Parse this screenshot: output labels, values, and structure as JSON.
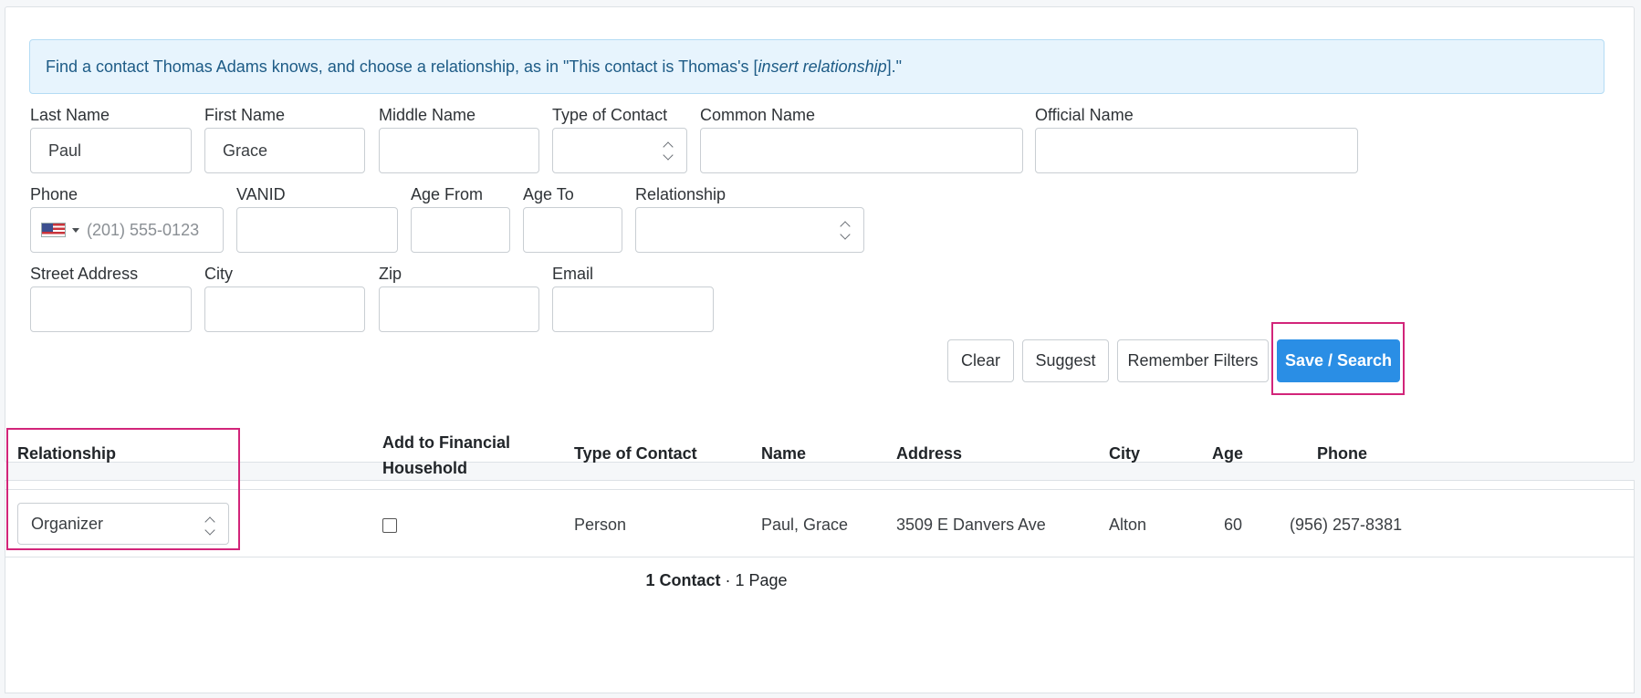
{
  "alert": {
    "prefix": "Find a contact Thomas Adams knows, and choose a relationship, as in \"This contact is Thomas's [",
    "emphasis": "insert relationship",
    "suffix": "].\""
  },
  "form": {
    "last_name": {
      "label": "Last Name",
      "value": "Paul"
    },
    "first_name": {
      "label": "First Name",
      "value": "Grace"
    },
    "middle_name": {
      "label": "Middle Name",
      "value": ""
    },
    "type_of_contact": {
      "label": "Type of Contact",
      "value": ""
    },
    "common_name": {
      "label": "Common Name",
      "value": ""
    },
    "official_name": {
      "label": "Official Name",
      "value": ""
    },
    "phone": {
      "label": "Phone",
      "placeholder": "(201) 555-0123",
      "country_icon": "us-flag-icon"
    },
    "vanid": {
      "label": "VANID",
      "value": ""
    },
    "age_from": {
      "label": "Age From",
      "value": ""
    },
    "age_to": {
      "label": "Age To",
      "value": ""
    },
    "relationship": {
      "label": "Relationship",
      "value": ""
    },
    "street_address": {
      "label": "Street Address",
      "value": ""
    },
    "city": {
      "label": "City",
      "value": ""
    },
    "zip": {
      "label": "Zip",
      "value": ""
    },
    "email": {
      "label": "Email",
      "value": ""
    }
  },
  "buttons": {
    "clear": "Clear",
    "suggest": "Suggest",
    "remember_filters": "Remember Filters",
    "save_search": "Save / Search"
  },
  "table": {
    "headers": {
      "relationship": "Relationship",
      "add_financial_1": "Add to Financial",
      "add_financial_2": "Household",
      "type_of_contact": "Type of Contact",
      "name": "Name",
      "address": "Address",
      "city": "City",
      "age": "Age",
      "phone": "Phone"
    },
    "rows": [
      {
        "relationship": "Organizer",
        "add_to_financial_household": false,
        "type_of_contact": "Person",
        "name": "Paul, Grace",
        "address": "3509 E Danvers Ave",
        "city": "Alton",
        "age": "60",
        "phone": "(956) 257-8381"
      }
    ],
    "footer": {
      "count": "1 Contact",
      "separator": " · ",
      "pages": "1 Page"
    }
  },
  "colors": {
    "primary": "#2a8ee5",
    "highlight": "#d2257a",
    "alert_bg": "#e7f4fd"
  }
}
